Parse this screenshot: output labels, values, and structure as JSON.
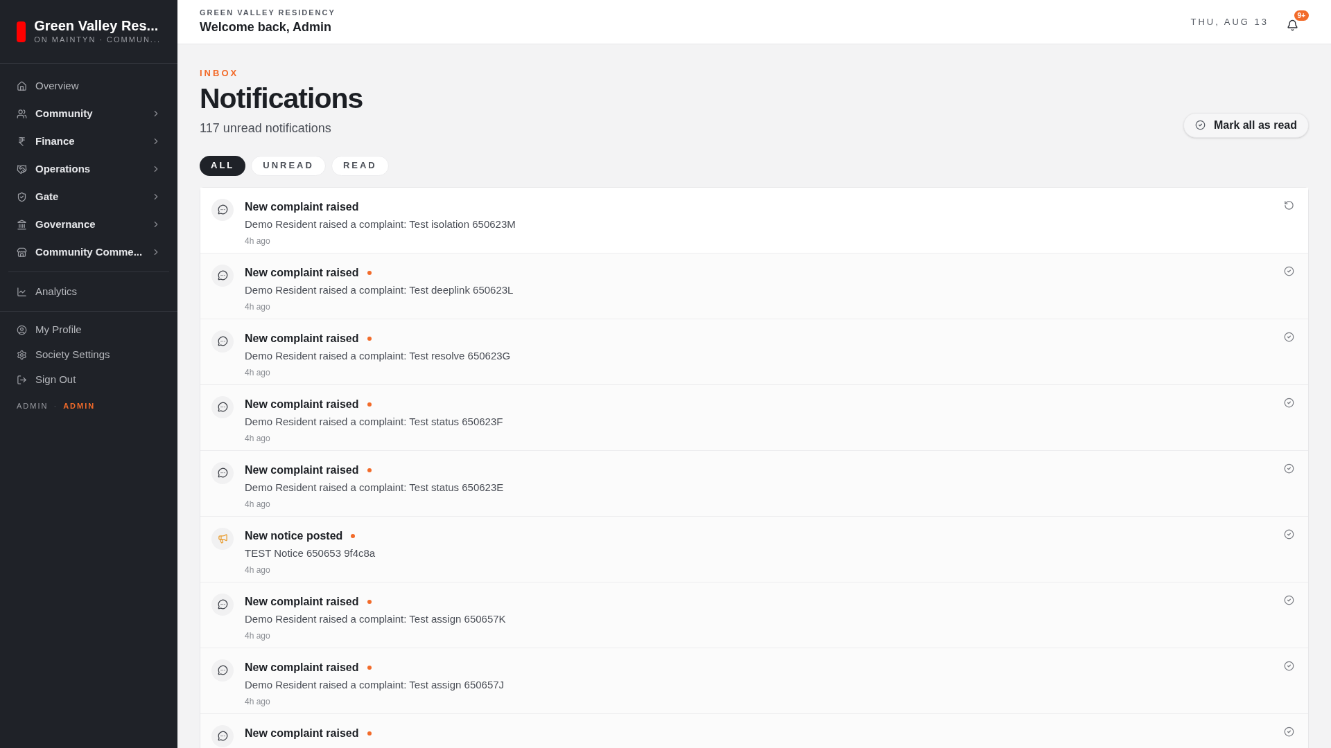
{
  "brand": {
    "name": "Green Valley Res...",
    "tagline": "ON MAINTYN · COMMUN..."
  },
  "sidebar": {
    "sections": [
      {
        "items": [
          {
            "label": "Overview",
            "expandable": false
          },
          {
            "label": "Community",
            "expandable": true
          },
          {
            "label": "Finance",
            "expandable": true
          },
          {
            "label": "Operations",
            "expandable": true
          },
          {
            "label": "Gate",
            "expandable": true
          },
          {
            "label": "Governance",
            "expandable": true
          },
          {
            "label": "Community Comme...",
            "expandable": true
          }
        ]
      },
      {
        "items": [
          {
            "label": "Analytics",
            "expandable": false
          }
        ]
      },
      {
        "items": [
          {
            "label": "My Profile",
            "expandable": false
          },
          {
            "label": "Society Settings",
            "expandable": false
          },
          {
            "label": "Sign Out",
            "expandable": false
          }
        ]
      }
    ],
    "footer": {
      "user": "ADMIN",
      "separator": "·",
      "role": "ADMIN"
    }
  },
  "header": {
    "society": "GREEN VALLEY RESIDENCY",
    "greeting": "Welcome back, Admin",
    "date": "THU, AUG 13",
    "badge": "9+"
  },
  "page": {
    "eyebrow": "INBOX",
    "title": "Notifications",
    "subtitle": "117 unread notifications",
    "action": "Mark all as read"
  },
  "tabs": [
    {
      "label": "ALL",
      "selected": true
    },
    {
      "label": "UNREAD",
      "selected": false
    },
    {
      "label": "READ",
      "selected": false
    }
  ],
  "notifications": [
    {
      "kind": "complaint",
      "title": "New complaint raised",
      "body": "Demo Resident raised a complaint: Test isolation 650623M",
      "time": "4h ago",
      "unread": false
    },
    {
      "kind": "complaint",
      "title": "New complaint raised",
      "body": "Demo Resident raised a complaint: Test deeplink 650623L",
      "time": "4h ago",
      "unread": true
    },
    {
      "kind": "complaint",
      "title": "New complaint raised",
      "body": "Demo Resident raised a complaint: Test resolve 650623G",
      "time": "4h ago",
      "unread": true
    },
    {
      "kind": "complaint",
      "title": "New complaint raised",
      "body": "Demo Resident raised a complaint: Test status 650623F",
      "time": "4h ago",
      "unread": true
    },
    {
      "kind": "complaint",
      "title": "New complaint raised",
      "body": "Demo Resident raised a complaint: Test status 650623E",
      "time": "4h ago",
      "unread": true
    },
    {
      "kind": "notice",
      "title": "New notice posted",
      "body": "TEST Notice 650653 9f4c8a",
      "time": "4h ago",
      "unread": true
    },
    {
      "kind": "complaint",
      "title": "New complaint raised",
      "body": "Demo Resident raised a complaint: Test assign 650657K",
      "time": "4h ago",
      "unread": true
    },
    {
      "kind": "complaint",
      "title": "New complaint raised",
      "body": "Demo Resident raised a complaint: Test assign 650657J",
      "time": "4h ago",
      "unread": true
    },
    {
      "kind": "complaint",
      "title": "New complaint raised",
      "unread": true
    }
  ]
}
